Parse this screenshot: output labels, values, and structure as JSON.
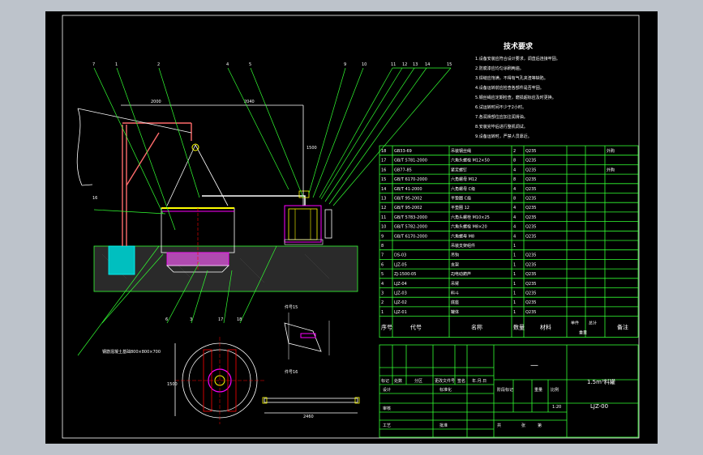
{
  "tech_requirements": {
    "title": "技术要求",
    "items": [
      "1.设备安装应符合设计要求，调直后连接牢固。",
      "2.防腐漆应均匀涂刷两遍。",
      "3.焊缝应饱满，不得有气孔夹渣等缺陷。",
      "4.设备运转前应检查各部件是否牢固。",
      "5.钢丝绳应定期检查，磨损超标应及时更换。",
      "6.试运转时间不少于2小时。",
      "7.各润滑部位应加注润滑油。",
      "8.安装完毕后进行整机调试。",
      "9.设备运转时，严禁人员靠近。"
    ]
  },
  "bom": {
    "rows": [
      {
        "no": "18",
        "code": "GB33-69",
        "name": "吊装钢丝绳",
        "qty": "2",
        "material": "Q235",
        "note": "外购"
      },
      {
        "no": "17",
        "code": "GB/T 5781-2000",
        "name": "六角头螺栓 M12×50",
        "qty": "8",
        "material": "Q235",
        "note": ""
      },
      {
        "no": "16",
        "code": "GB77-85",
        "name": "紧定螺钉",
        "qty": "4",
        "material": "Q235",
        "note": "外购"
      },
      {
        "no": "15",
        "code": "GB/T 6170-2000",
        "name": "六角螺母 M12",
        "qty": "8",
        "material": "Q235",
        "note": ""
      },
      {
        "no": "14",
        "code": "GB/T 41-2000",
        "name": "六角螺母 C级",
        "qty": "4",
        "material": "Q235",
        "note": ""
      },
      {
        "no": "13",
        "code": "GB/T 95-2002",
        "name": "平垫圈 C级",
        "qty": "8",
        "material": "Q235",
        "note": ""
      },
      {
        "no": "12",
        "code": "GB/T 95-2002",
        "name": "平垫圈 12",
        "qty": "4",
        "material": "Q235",
        "note": ""
      },
      {
        "no": "11",
        "code": "GB/T 5783-2000",
        "name": "六角头螺栓 M10×25",
        "qty": "4",
        "material": "Q235",
        "note": ""
      },
      {
        "no": "10",
        "code": "GB/T 5782-2000",
        "name": "六角头螺栓 M8×20",
        "qty": "4",
        "material": "Q235",
        "note": ""
      },
      {
        "no": "9",
        "code": "GB/T 6170-2000",
        "name": "六角螺母 M8",
        "qty": "4",
        "material": "Q235",
        "note": ""
      },
      {
        "no": "8",
        "code": "",
        "name": "吊装支架组件",
        "qty": "1",
        "material": "",
        "note": ""
      },
      {
        "no": "7",
        "code": "DS-03",
        "name": "吊钩",
        "qty": "1",
        "material": "Q235",
        "note": ""
      },
      {
        "no": "6",
        "code": "LJZ-05",
        "name": "支架",
        "qty": "1",
        "material": "Q235",
        "note": ""
      },
      {
        "no": "5",
        "code": "ZJ-1500-05",
        "name": "ZJ电动葫芦",
        "qty": "1",
        "material": "Q235",
        "note": ""
      },
      {
        "no": "4",
        "code": "LJZ-04",
        "name": "吊臂",
        "qty": "1",
        "material": "Q235",
        "note": ""
      },
      {
        "no": "3",
        "code": "LJZ-03",
        "name": "料斗",
        "qty": "1",
        "material": "Q235",
        "note": ""
      },
      {
        "no": "2",
        "code": "LJZ-02",
        "name": "底座",
        "qty": "1",
        "material": "Q235",
        "note": ""
      },
      {
        "no": "1",
        "code": "LJZ-01",
        "name": "罐体",
        "qty": "1",
        "material": "Q235",
        "note": ""
      }
    ],
    "header": {
      "no": "序号",
      "code": "代号",
      "name": "名称",
      "qty": "数量",
      "material": "材料",
      "unit_w": "单件",
      "total_w": "总计",
      "weight": "重量",
      "note": "备注"
    }
  },
  "title_block": {
    "dash": "—",
    "drawing_title": "1.5m³料罐",
    "drawing_no": "LJZ-00",
    "scale": "1:20",
    "labels": {
      "mark": "标记",
      "count": "处数",
      "zone": "分区",
      "change_no": "更改文件号",
      "sign": "签名",
      "date": "年.月.日",
      "design": "设计",
      "standardize": "标准化",
      "review": "审核",
      "process": "工艺",
      "approve": "批准",
      "stage": "阶段标记",
      "weight": "重量",
      "ratio": "比例",
      "sheet_total": "共",
      "sheet": "张",
      "sheet_no": "第"
    }
  },
  "callouts": [
    "7",
    "1",
    "2",
    "3",
    "4",
    "5",
    "6",
    "17",
    "18",
    "9",
    "10",
    "11",
    "12",
    "13",
    "14",
    "15",
    "16"
  ],
  "dims": {
    "d1": "2000",
    "d2": "2040",
    "d3": "1500",
    "d4": "2460"
  },
  "annotations": {
    "base_note": "钢筋混凝土基础800×800×700",
    "detail_a": "件号15",
    "detail_b": "件号16"
  },
  "colors": {
    "line": "#32ff32",
    "text": "#ffffff",
    "magenta": "#ff00ff",
    "yellow": "#ffff00",
    "cyan": "#00ffff",
    "red": "#ff0000",
    "background": "#000000"
  }
}
